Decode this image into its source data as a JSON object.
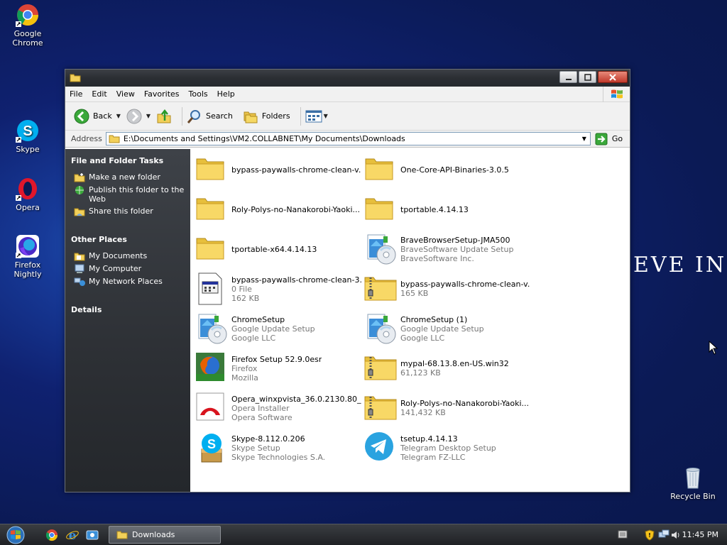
{
  "desktop": {
    "icons": [
      {
        "label_line1": "Google",
        "label_line2": "Chrome",
        "icon": "chrome-icon"
      },
      {
        "label_line1": "Skype",
        "label_line2": "",
        "icon": "skype-icon"
      },
      {
        "label_line1": "Opera",
        "label_line2": "",
        "icon": "opera-icon"
      },
      {
        "label_line1": "Firefox",
        "label_line2": "Nightly",
        "icon": "firefox-nightly-icon"
      },
      {
        "label_line1": "Recycle Bin",
        "label_line2": "",
        "icon": "recycle-bin-icon"
      }
    ],
    "wallpaper_text": "EVE IN"
  },
  "window": {
    "menu": [
      "File",
      "Edit",
      "View",
      "Favorites",
      "Tools",
      "Help"
    ],
    "toolbar": {
      "back_label": "Back",
      "search_label": "Search",
      "folders_label": "Folders"
    },
    "address": {
      "label": "Address",
      "path": "E:\\Documents and Settings\\VM2.COLLABNET\\My Documents\\Downloads",
      "go_label": "Go"
    },
    "taskpane": {
      "file_tasks_title": "File and Folder Tasks",
      "file_tasks": [
        {
          "label_line1": "Make a new folder",
          "label_line2": ""
        },
        {
          "label_line1": "Publish this folder to the",
          "label_line2": "Web"
        },
        {
          "label_line1": "Share this folder",
          "label_line2": ""
        }
      ],
      "other_places_title": "Other Places",
      "other_places": [
        "My Documents",
        "My Computer",
        "My Network Places"
      ],
      "details_title": "Details"
    },
    "files": [
      {
        "name": "bypass-paywalls-chrome-clean-v...",
        "line2": "",
        "line3": "",
        "type": "folder"
      },
      {
        "name": "One-Core-API-Binaries-3.0.5",
        "line2": "",
        "line3": "",
        "type": "folder"
      },
      {
        "name": "Roly-Polys-no-Nanakorobi-Yaoki...",
        "line2": "",
        "line3": "",
        "type": "folder"
      },
      {
        "name": "tportable.4.14.13",
        "line2": "",
        "line3": "",
        "type": "folder"
      },
      {
        "name": "tportable-x64.4.14.13",
        "line2": "",
        "line3": "",
        "type": "folder"
      },
      {
        "name": "BraveBrowserSetup-JMA500",
        "line2": "BraveSoftware Update Setup",
        "line3": "BraveSoftware Inc.",
        "type": "setup"
      },
      {
        "name": "bypass-paywalls-chrome-clean-3....",
        "line2": "0 File",
        "line3": "162 KB",
        "type": "file"
      },
      {
        "name": "bypass-paywalls-chrome-clean-v...",
        "line2": "165 KB",
        "line3": "",
        "type": "zip"
      },
      {
        "name": "ChromeSetup",
        "line2": "Google Update Setup",
        "line3": "Google LLC",
        "type": "setup"
      },
      {
        "name": "ChromeSetup (1)",
        "line2": "Google Update Setup",
        "line3": "Google LLC",
        "type": "setup"
      },
      {
        "name": "Firefox Setup 52.9.0esr",
        "line2": "Firefox",
        "line3": "Mozilla",
        "type": "firefox"
      },
      {
        "name": "mypal-68.13.8.en-US.win32",
        "line2": "61,123 KB",
        "line3": "",
        "type": "zip"
      },
      {
        "name": "Opera_winxpvista_36.0.2130.80_...",
        "line2": "Opera Installer",
        "line3": "Opera Software",
        "type": "opera"
      },
      {
        "name": "Roly-Polys-no-Nanakorobi-Yaoki...",
        "line2": "141,432 KB",
        "line3": "",
        "type": "zip"
      },
      {
        "name": "Skype-8.112.0.206",
        "line2": "Skype Setup",
        "line3": "Skype Technologies S.A.",
        "type": "skype"
      },
      {
        "name": "tsetup.4.14.13",
        "line2": "Telegram Desktop Setup",
        "line3": "Telegram FZ-LLC",
        "type": "telegram"
      }
    ]
  },
  "taskbar": {
    "task_label": "Downloads",
    "clock": "11:45 PM"
  }
}
